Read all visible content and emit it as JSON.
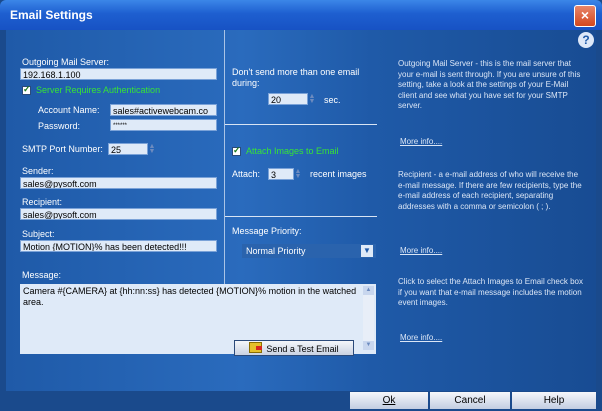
{
  "window": {
    "title": "Email Settings",
    "close_glyph": "×"
  },
  "help_icon": "?",
  "outgoing": {
    "label": "Outgoing Mail Server:",
    "value": "192.168.1.100"
  },
  "auth": {
    "label": "Server Requires Authentication",
    "checked": true,
    "account_label": "Account Name:",
    "account_value": "sales#activewebcam.co",
    "password_label": "Password:",
    "password_value": "******"
  },
  "smtp": {
    "label": "SMTP Port Number:",
    "value": "25"
  },
  "sender": {
    "label": "Sender:",
    "value": "sales@pysoft.com"
  },
  "recipient": {
    "label": "Recipient:",
    "value": "sales@pysoft.com"
  },
  "subject": {
    "label": "Subject:",
    "value": "Motion {MOTION}% has been detected!!!"
  },
  "rate": {
    "label_line1": "Don't send more than one email",
    "label_line2": "during:",
    "value": "20",
    "unit": "sec."
  },
  "attach": {
    "label": "Attach Images to Email",
    "checked": true,
    "attach_label": "Attach:",
    "value": "3",
    "suffix": "recent images"
  },
  "priority": {
    "label": "Message Priority:",
    "value": "Normal Priority"
  },
  "message": {
    "label": "Message:",
    "value": "Camera #{CAMERA} at {hh:nn:ss} has detected {MOTION}% motion in the watched area."
  },
  "test_button": "Send a Test Email",
  "help_texts": [
    "Outgoing Mail Server - this is the mail server that your e-mail is sent through. If you are unsure of this setting, take a look at the settings of your E-Mail client and see what you have set for your SMTP server.",
    "Recipient - a e-mail address of who will receive the e-mail message. If there are few recipients, type the e-mail address of each recipient, separating addresses with a comma or semicolon ( ; ).",
    "Click to select the Attach Images to Email check box if you want that e-mail message includes the motion event images."
  ],
  "more_info": "More info....",
  "footer": {
    "ok": "Ok",
    "cancel": "Cancel",
    "help": "Help"
  }
}
